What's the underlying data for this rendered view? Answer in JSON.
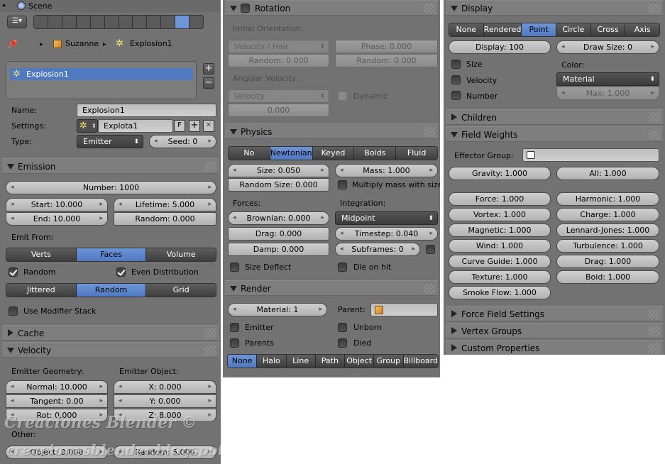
{
  "p1": {
    "topbar": {
      "scene_label": "Scene"
    },
    "breadcrumb": {
      "object": "Suzanne",
      "system": "Explosion1"
    },
    "list": {
      "selected_item": "Explosion1",
      "add": "+",
      "remove": "−"
    },
    "name": {
      "label": "Name:",
      "value": "Explosion1"
    },
    "settings": {
      "label": "Settings:",
      "value": "Explota1",
      "f_btn": "F"
    },
    "type": {
      "label": "Type:",
      "value": "Emitter",
      "seed": "Seed: 0"
    },
    "emission": {
      "header": "Emission",
      "number": "Number: 1000",
      "start": "Start: 10.000",
      "end": "End: 10.000",
      "lifetime": "Lifetime: 5.000",
      "random": "Random: 0.000",
      "emit_from_label": "Emit From:",
      "emit_from": [
        "Verts",
        "Faces",
        "Volume"
      ],
      "random_cb": "Random",
      "even_dist": "Even Distribution",
      "distribution": [
        "Jittered",
        "Random",
        "Grid"
      ],
      "modifier_stack": "Use Modifier Stack"
    },
    "cache": {
      "header": "Cache"
    },
    "velocity": {
      "header": "Velocity",
      "geom_label": "Emitter Geometry:",
      "obj_label": "Emitter Object:",
      "normal": "Normal: 10.000",
      "tangent": "Tangent: 0.00",
      "rot": "Rot: 0.000",
      "x": "X: 0.000",
      "y": "Y: 0.000",
      "z": "Z: 8.000",
      "other_label": "Other:",
      "object": "Object: 0.000",
      "random": "Random: 5.000"
    },
    "watermark": {
      "line1": "Creaciones Blender ©",
      "line2": "creacionesblender.blogspot.com"
    }
  },
  "p2": {
    "rotation": {
      "header": "Rotation",
      "init_label": "Initial Orientation:",
      "init_select": "Velocity / Hair",
      "phase": "Phase: 0.000",
      "random1": "Random: 0.000",
      "random2": "Random: 0.000",
      "ang_label": "Angular Velocity:",
      "ang_select": "Velocity",
      "dynamic": "Dynamic",
      "ang_value": "0.000"
    },
    "physics": {
      "header": "Physics",
      "types": [
        "No",
        "Newtonian",
        "Keyed",
        "Boids",
        "Fluid"
      ],
      "size": "Size: 0.050",
      "random_size": "Random Size: 0.000",
      "mass": "Mass: 1.000",
      "multiply_mass": "Multiply mass with size",
      "forces_label": "Forces:",
      "integration_label": "Integration:",
      "brownian": "Brownian: 0.000",
      "drag": "Drag: 0.000",
      "damp": "Damp: 0.000",
      "integration": "Midpoint",
      "timestep": "Timestep: 0.040",
      "subframes": "Subframes: 0",
      "size_deflect": "Size Deflect",
      "die_on_hit": "Die on hit"
    },
    "render": {
      "header": "Render",
      "material": "Material: 1",
      "parent_label": "Parent:",
      "emitter": "Emitter",
      "unborn": "Unborn",
      "parents": "Parents",
      "died": "Died",
      "modes": [
        "None",
        "Halo",
        "Line",
        "Path",
        "Object",
        "Group",
        "Billboard"
      ]
    }
  },
  "p3": {
    "display": {
      "header": "Display",
      "modes": [
        "None",
        "Rendered",
        "Point",
        "Circle",
        "Cross",
        "Axis"
      ],
      "display": "Display: 100",
      "draw_size": "Draw Size: 0",
      "size": "Size",
      "velocity": "Velocity",
      "number": "Number",
      "color_label": "Color:",
      "color_value": "Material",
      "max": "Max: 1.000"
    },
    "children": {
      "header": "Children"
    },
    "field_weights": {
      "header": "Field Weights",
      "effector_label": "Effector Group:",
      "gravity": "Gravity: 1.000",
      "all": "All: 1.000",
      "left": [
        "Force: 1.000",
        "Vortex: 1.000",
        "Magnetic: 1.000",
        "Wind: 1.000",
        "Curve Guide: 1.000",
        "Texture: 1.000",
        "Smoke Flow: 1.000"
      ],
      "right": [
        "Harmonic: 1.000",
        "Charge: 1.000",
        "Lennard-Jones: 1.000",
        "Turbulence: 1.000",
        "Drag: 1.000",
        "Boid: 1.000"
      ]
    },
    "force_field": {
      "header": "Force Field Settings"
    },
    "vertex_groups": {
      "header": "Vertex Groups"
    },
    "custom_props": {
      "header": "Custom Properties"
    }
  }
}
